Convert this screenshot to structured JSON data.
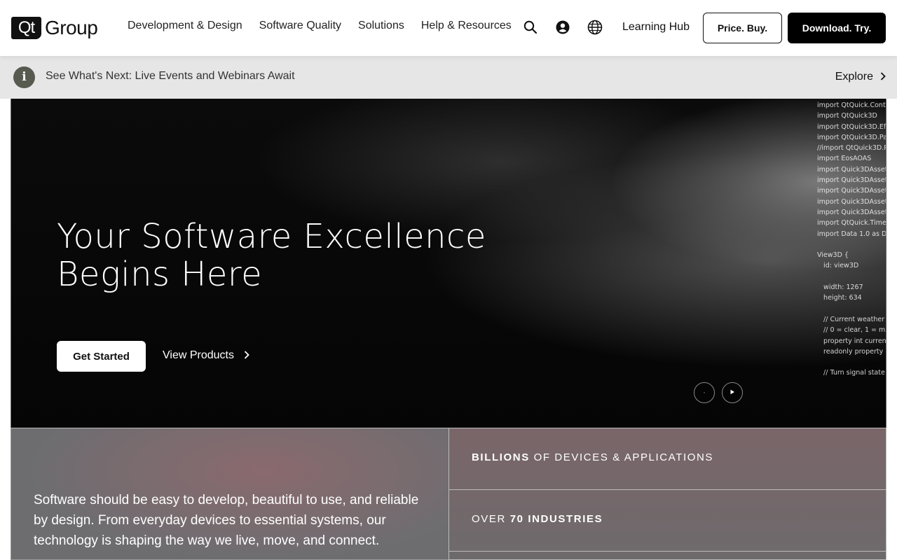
{
  "header": {
    "logo_mark": "Qt",
    "logo_word": "Group",
    "nav": [
      {
        "label": "Development & Design"
      },
      {
        "label": "Software Quality"
      },
      {
        "label": "Solutions"
      },
      {
        "label": "Help & Resources"
      }
    ],
    "icons": [
      "search-icon",
      "account-icon",
      "globe-icon"
    ],
    "learning_hub": "Learning Hub",
    "price_buy": "Price. Buy.",
    "download_try": "Download. Try."
  },
  "banner": {
    "icon": "info-icon",
    "icon_glyph": "i",
    "text": "See What's Next: Live Events and Webinars Await",
    "link": "Explore"
  },
  "hero": {
    "title_line1": "Your Software Excellence",
    "title_line2": "Begins Here",
    "primary_button": "Get Started",
    "secondary_link": "View Products",
    "code_lines": "import QtQuick.Controls\nimport QtQuick3D\nimport QtQuick3D.Effects\nimport QtQuick3D.Particles\n//import QtQuick3D.Particles\nimport EosAOAS\nimport Quick3DAssets.Rc\nimport Quick3DAssets.Gc\nimport Quick3DAssets.Ge\nimport Quick3DAssets.La\nimport Quick3DAssets.Da\nimport QtQuick.Timeline\nimport Data 1.0 as Data\n\nView3D {\n   id: view3D\n\n   width: 1267\n   height: 634\n\n   // Current weather mod\n   // 0 = clear, 1 = mist, 2 =\n   property int currentWea\n   readonly property int ef\n\n   // Turn signal state",
    "controls": [
      "pause-icon",
      "play-icon"
    ]
  },
  "stats": {
    "description": "Software should be easy to develop, beautiful to use, and reliable by design. From everyday devices to essential systems, our technology is shaping the way we live, move, and connect.",
    "rows": [
      {
        "bold": "BILLIONS",
        "rest": " OF DEVICES & APPLICATIONS"
      },
      {
        "prefix": "OVER ",
        "bold": "70 INDUSTRIES"
      }
    ]
  }
}
